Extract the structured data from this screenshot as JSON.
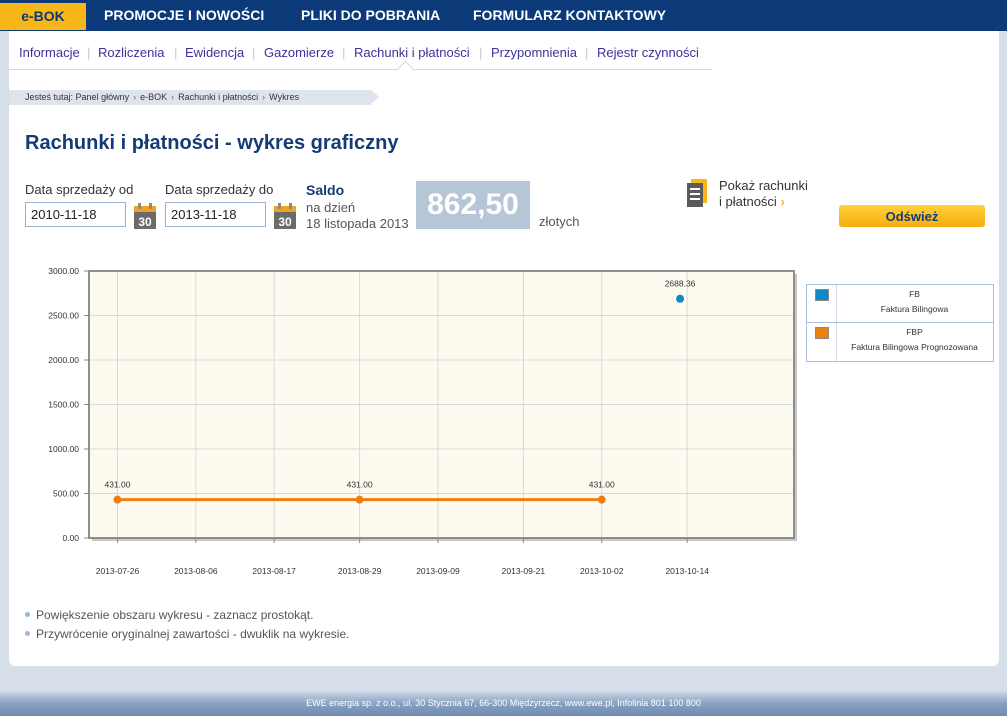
{
  "topnav": {
    "home": "e-BOK",
    "items": [
      "PROMOCJE I NOWOŚCI",
      "PLIKI DO POBRANIA",
      "FORMULARZ KONTAKTOWY"
    ]
  },
  "subnav": {
    "items": [
      "Informacje",
      "Rozliczenia",
      "Ewidencja",
      "Gazomierze",
      "Rachunki i płatności",
      "Przypomnienia",
      "Rejestr czynności"
    ],
    "active": "Rachunki i płatności"
  },
  "breadcrumb": {
    "prefix": "Jesteś tutaj:",
    "items": [
      "Panel główny",
      "e-BOK",
      "Rachunki i płatności",
      "Wykres"
    ]
  },
  "page_title": "Rachunki i płatności - wykres graficzny",
  "filters": {
    "from_label": "Data sprzedaży od",
    "from_value": "2010-11-18",
    "to_label": "Data sprzedaży do",
    "to_value": "2013-11-18",
    "calendar_day": "30"
  },
  "saldo": {
    "title": "Saldo",
    "on_day": "na dzień",
    "date": "18 listopada 2013",
    "amount": "862,50",
    "currency": "złotych"
  },
  "show_link": {
    "line1": "Pokaż rachunki",
    "line2": "i płatności",
    "chevron": "›"
  },
  "refresh_label": "Odśwież",
  "chart_data": {
    "type": "scatter",
    "x_tick_labels": [
      "2013-07-26",
      "2013-08-06",
      "2013-08-17",
      "2013-08-29",
      "2013-09-09",
      "2013-09-21",
      "2013-10-02",
      "2013-10-14"
    ],
    "y_tick_labels": [
      "0.00",
      "500.00",
      "1000.00",
      "1500.00",
      "2000.00",
      "2500.00",
      "3000.00"
    ],
    "xlim": [
      "2013-07-22",
      "2013-10-29"
    ],
    "ylim": [
      0,
      3000
    ],
    "grid": true,
    "legend_position": "right",
    "series": [
      {
        "name": "FB",
        "color": "#0e88c9",
        "connect": false,
        "points": [
          {
            "x": "2013-10-13",
            "y": 2688.36,
            "label": "2688.36"
          }
        ]
      },
      {
        "name": "FBP",
        "color": "#ef7f0e",
        "connect": true,
        "points": [
          {
            "x": "2013-07-26",
            "y": 431.0,
            "label": "431.00"
          },
          {
            "x": "2013-08-29",
            "y": 431.0,
            "label": "431.00"
          },
          {
            "x": "2013-10-02",
            "y": 431.0,
            "label": "431.00"
          }
        ]
      }
    ]
  },
  "legend": [
    {
      "code": "FB",
      "description": "Faktura Bilingowa",
      "color": "#0e88c9"
    },
    {
      "code": "FBP",
      "description": "Faktura Bilingowa Prognozowana",
      "color": "#ef7f0e"
    }
  ],
  "notes": [
    "Powiększenie obszaru wykresu - zaznacz prostokąt.",
    "Przywrócenie oryginalnej zawartości - dwuklik na wykresie."
  ],
  "footer": "EWE energia sp. z o.o., ul. 30 Stycznia 67, 66-300 Międzyrzecz, www.ewe.pl, Infolinia 801 100 800"
}
